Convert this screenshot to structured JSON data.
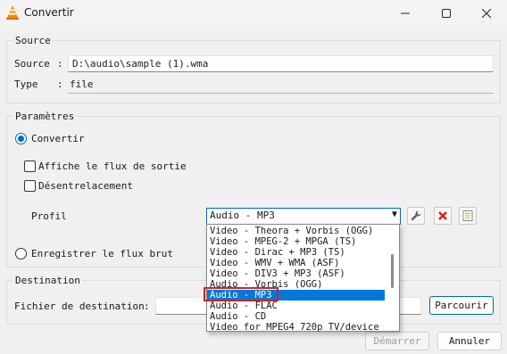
{
  "window": {
    "title": "Convertir"
  },
  "source": {
    "legend": "Source",
    "source_label": "Source",
    "source_value": "D:\\audio\\sample (1).wma",
    "type_label": "Type",
    "type_value": "file"
  },
  "params": {
    "legend": "Paramètres",
    "convert_label": "Convertir",
    "show_output_label": "Affiche le flux de sortie",
    "deinterlace_label": "Désentrelacement",
    "profile_label": "Profil",
    "profile_selected": "Audio - MP3",
    "dump_raw_label": "Enregistrer le flux brut",
    "profile_options": [
      "Video - Theora + Vorbis (OGG)",
      "Video - MPEG-2 + MPGA (TS)",
      "Video - Dirac + MP3 (TS)",
      "Video - WMV + WMA (ASF)",
      "Video - DIV3 + MP3 (ASF)",
      "Audio - Vorbis (OGG)",
      "Audio - MP3",
      "Audio - FLAC",
      "Audio - CD",
      "Video for MPEG4 720p TV/device"
    ]
  },
  "destination": {
    "legend": "Destination",
    "file_label": "Fichier de destination",
    "browse_label": "Parcourir"
  },
  "footer": {
    "start_label": "Démarrer",
    "cancel_label": "Annuler"
  }
}
